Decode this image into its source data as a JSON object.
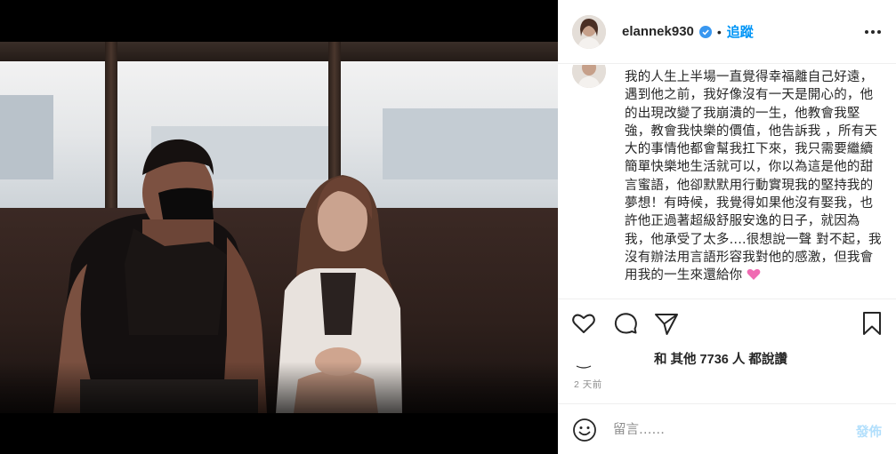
{
  "post": {
    "username": "elannek930",
    "separator": "•",
    "follow_label": "追蹤",
    "verified_icon": "verified-badge-icon",
    "more_icon": "more-options-icon",
    "caption": "我的人生上半場一直覺得幸福離自己好遠，遇到他之前，我好像沒有一天是開心的，他的出現改變了我崩潰的一生，他教會我堅強，教會我快樂的價值，他告訴我 ，所有天大的事情他都會幫我扛下來，我只需要繼續簡單快樂地生活就可以，你以為這是他的甜言蜜語，他卻默默用行動實現我的堅持我的夢想！有時候，我覺得如果他沒有娶我，也許他正過著超級舒服安逸的日子，就因為我，他承受了太多....很想說一聲 對不起，我沒有辦法用言語形容我對他的感激，但我會用我的一生來還給你 ",
    "likes_prefix": "和",
    "likes_text": "其他 7736 人",
    "likes_suffix": "都說讚",
    "timestamp": "2 天前"
  },
  "actions": {
    "like_icon": "heart-icon",
    "comment_icon": "comment-icon",
    "share_icon": "share-icon",
    "save_icon": "bookmark-icon"
  },
  "comment_bar": {
    "emoji_icon": "smile-icon",
    "placeholder": "留言……",
    "post_label": "發佈"
  },
  "colors": {
    "link_blue": "#0095f6",
    "post_disabled": "#b2dffc",
    "muted": "#8e8e8e",
    "text": "#262626"
  }
}
